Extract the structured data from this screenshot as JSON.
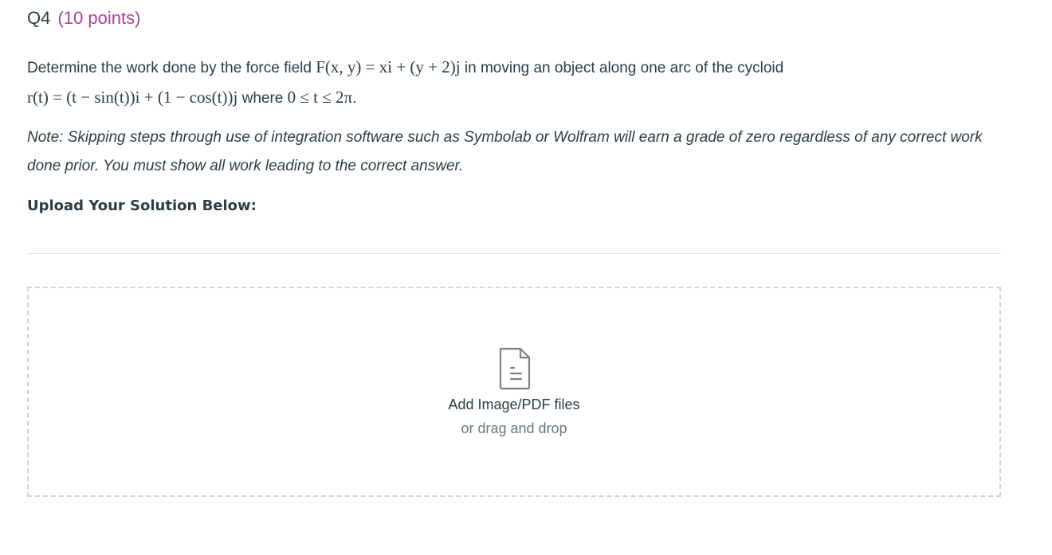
{
  "question": {
    "number": "Q4",
    "points": "(10 points)"
  },
  "prompt": {
    "text_1": "Determine the work done by the force field ",
    "math_1": "F(x, y) = xi + (y + 2)j",
    "text_2": " in moving an object along one arc of the cycloid",
    "math_2": "r(t) = (t − sin(t))i + (1 − cos(t))j",
    "text_3": " where ",
    "math_3": "0 ≤ t ≤ 2π",
    "text_4": "."
  },
  "note": "Note: Skipping steps through use of integration software such as Symbolab or Wolfram will earn a grade of zero regardless of any correct work done prior. You must show all work leading to the correct answer.",
  "upload": {
    "heading": "Upload Your Solution Below:",
    "dropzone_title": "Add Image/PDF files",
    "dropzone_subtitle": "or drag and drop",
    "icon": "file-icon"
  },
  "colors": {
    "points": "#a8449a",
    "text": "#2d3b45",
    "muted": "#6b7780",
    "border": "#d3d7db"
  }
}
